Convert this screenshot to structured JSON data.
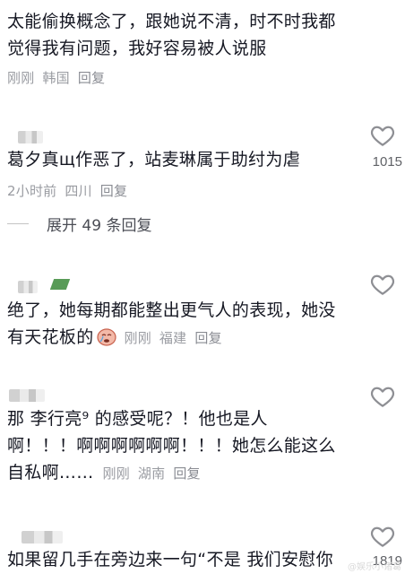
{
  "comments": [
    {
      "lines": [
        "太能偷换概念了，跟她说不清，时不时我都",
        "觉得我有问题，我好容易被人说服"
      ],
      "time": "刚刚",
      "location": "韩国",
      "reply_label": "回复"
    },
    {
      "lines": [
        "葛夕真щ作恶了，站麦琳属于助纣为虐"
      ],
      "time": "2小时前",
      "location": "四川",
      "reply_label": "回复",
      "likes": "1015"
    },
    {
      "lines": [
        "绝了，她每期都能整出更气人的表现，她没",
        "有天花板的"
      ],
      "time": "刚刚",
      "location": "福建",
      "reply_label": "回复"
    },
    {
      "lines": [
        "那 李行亮⁹ 的感受呢？！他也是人",
        "啊！！！啊啊啊啊啊啊！！！她怎么能这么",
        "自私啊……"
      ],
      "time": "刚刚",
      "location": "湖南",
      "reply_label": "回复"
    },
    {
      "lines": [
        "如果留几手在旁边来一句“不是 我们安慰你"
      ],
      "likes": "1819"
    }
  ],
  "expand_replies": "展开 49 条回复",
  "icons": {
    "like": "heart-outline-icon",
    "emoji": "crying-face-emoji-icon"
  },
  "colors": {
    "text": "#161823",
    "meta": "#9a9ca2",
    "icon": "#8e8f94"
  },
  "watermark": "@娱乐小诸葛"
}
